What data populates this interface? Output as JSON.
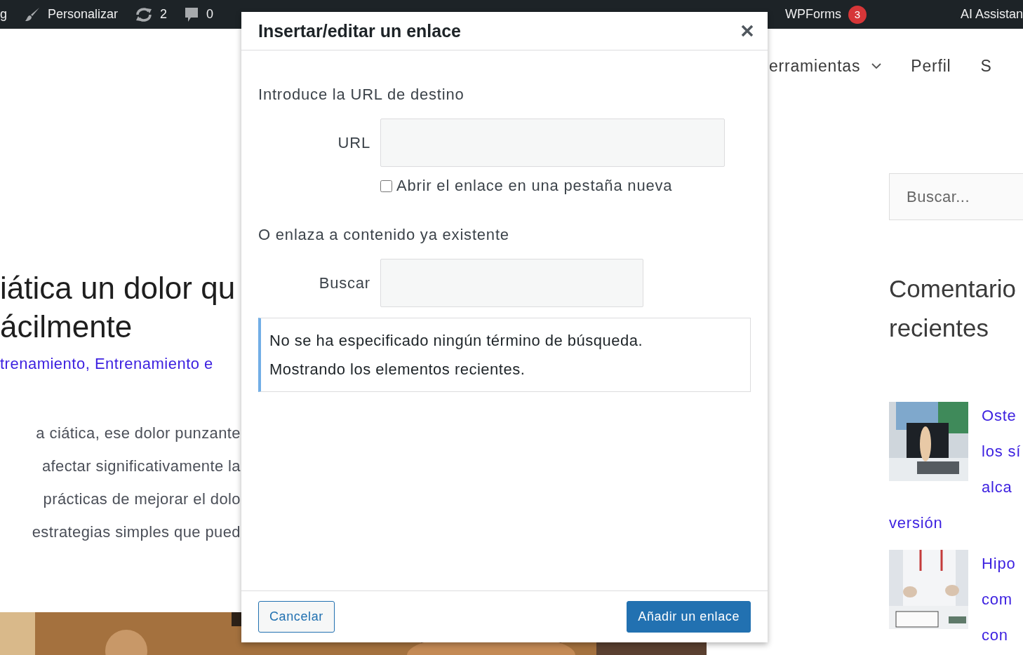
{
  "admin_bar": {
    "items": [
      {
        "kind": "text",
        "label": "g"
      },
      {
        "kind": "brush",
        "label": "Personalizar"
      },
      {
        "kind": "updates",
        "label": "2"
      },
      {
        "kind": "comments",
        "label": "0"
      },
      {
        "kind": "text",
        "label": "WPForms",
        "badge": "3"
      }
    ],
    "account": "AI Assistan"
  },
  "article": {
    "title_lines": [
      "iática un dolor qu",
      "ácilmente"
    ],
    "categories": "trenamiento, Entrenamiento e",
    "paragraph_lines": [
      "a ciática, ese dolor punzante",
      "afectar significativamente la",
      "prácticas de mejorar el dolo",
      "estrategias simples que pued"
    ],
    "featured_image": {
      "kind": "picture"
    }
  },
  "nav": [
    {
      "label": "erramientas",
      "has_dropdown": true
    },
    {
      "label": "Perfil",
      "has_dropdown": false
    },
    {
      "label": "S",
      "has_dropdown": false
    }
  ],
  "sidebar": {
    "search": {
      "placeholder": "Buscar..."
    },
    "heading_lines": [
      "Comentario",
      "recientes"
    ],
    "posts": [
      {
        "title_lines": [
          "Oste",
          "los sí",
          "alca"
        ],
        "tail": "versión"
      },
      {
        "title_lines": [
          "Hipo",
          "com",
          "con"
        ]
      }
    ]
  },
  "dialog": {
    "title": "Insertar/editar un enlace",
    "url_section": {
      "heading": "Introduce la URL de destino",
      "label": "URL",
      "new_tab": {
        "label": "Abrir el enlace en una pestaña nueva",
        "checked": false
      }
    },
    "link_section": {
      "heading": "O enlaza a contenido ya existente",
      "label": "Buscar"
    },
    "notice": [
      "No se ha especificado ningún término de búsqueda.",
      "Mostrando los elementos recientes."
    ],
    "buttons": {
      "cancel": "Cancelar",
      "submit": "Añadir un enlace"
    }
  }
}
